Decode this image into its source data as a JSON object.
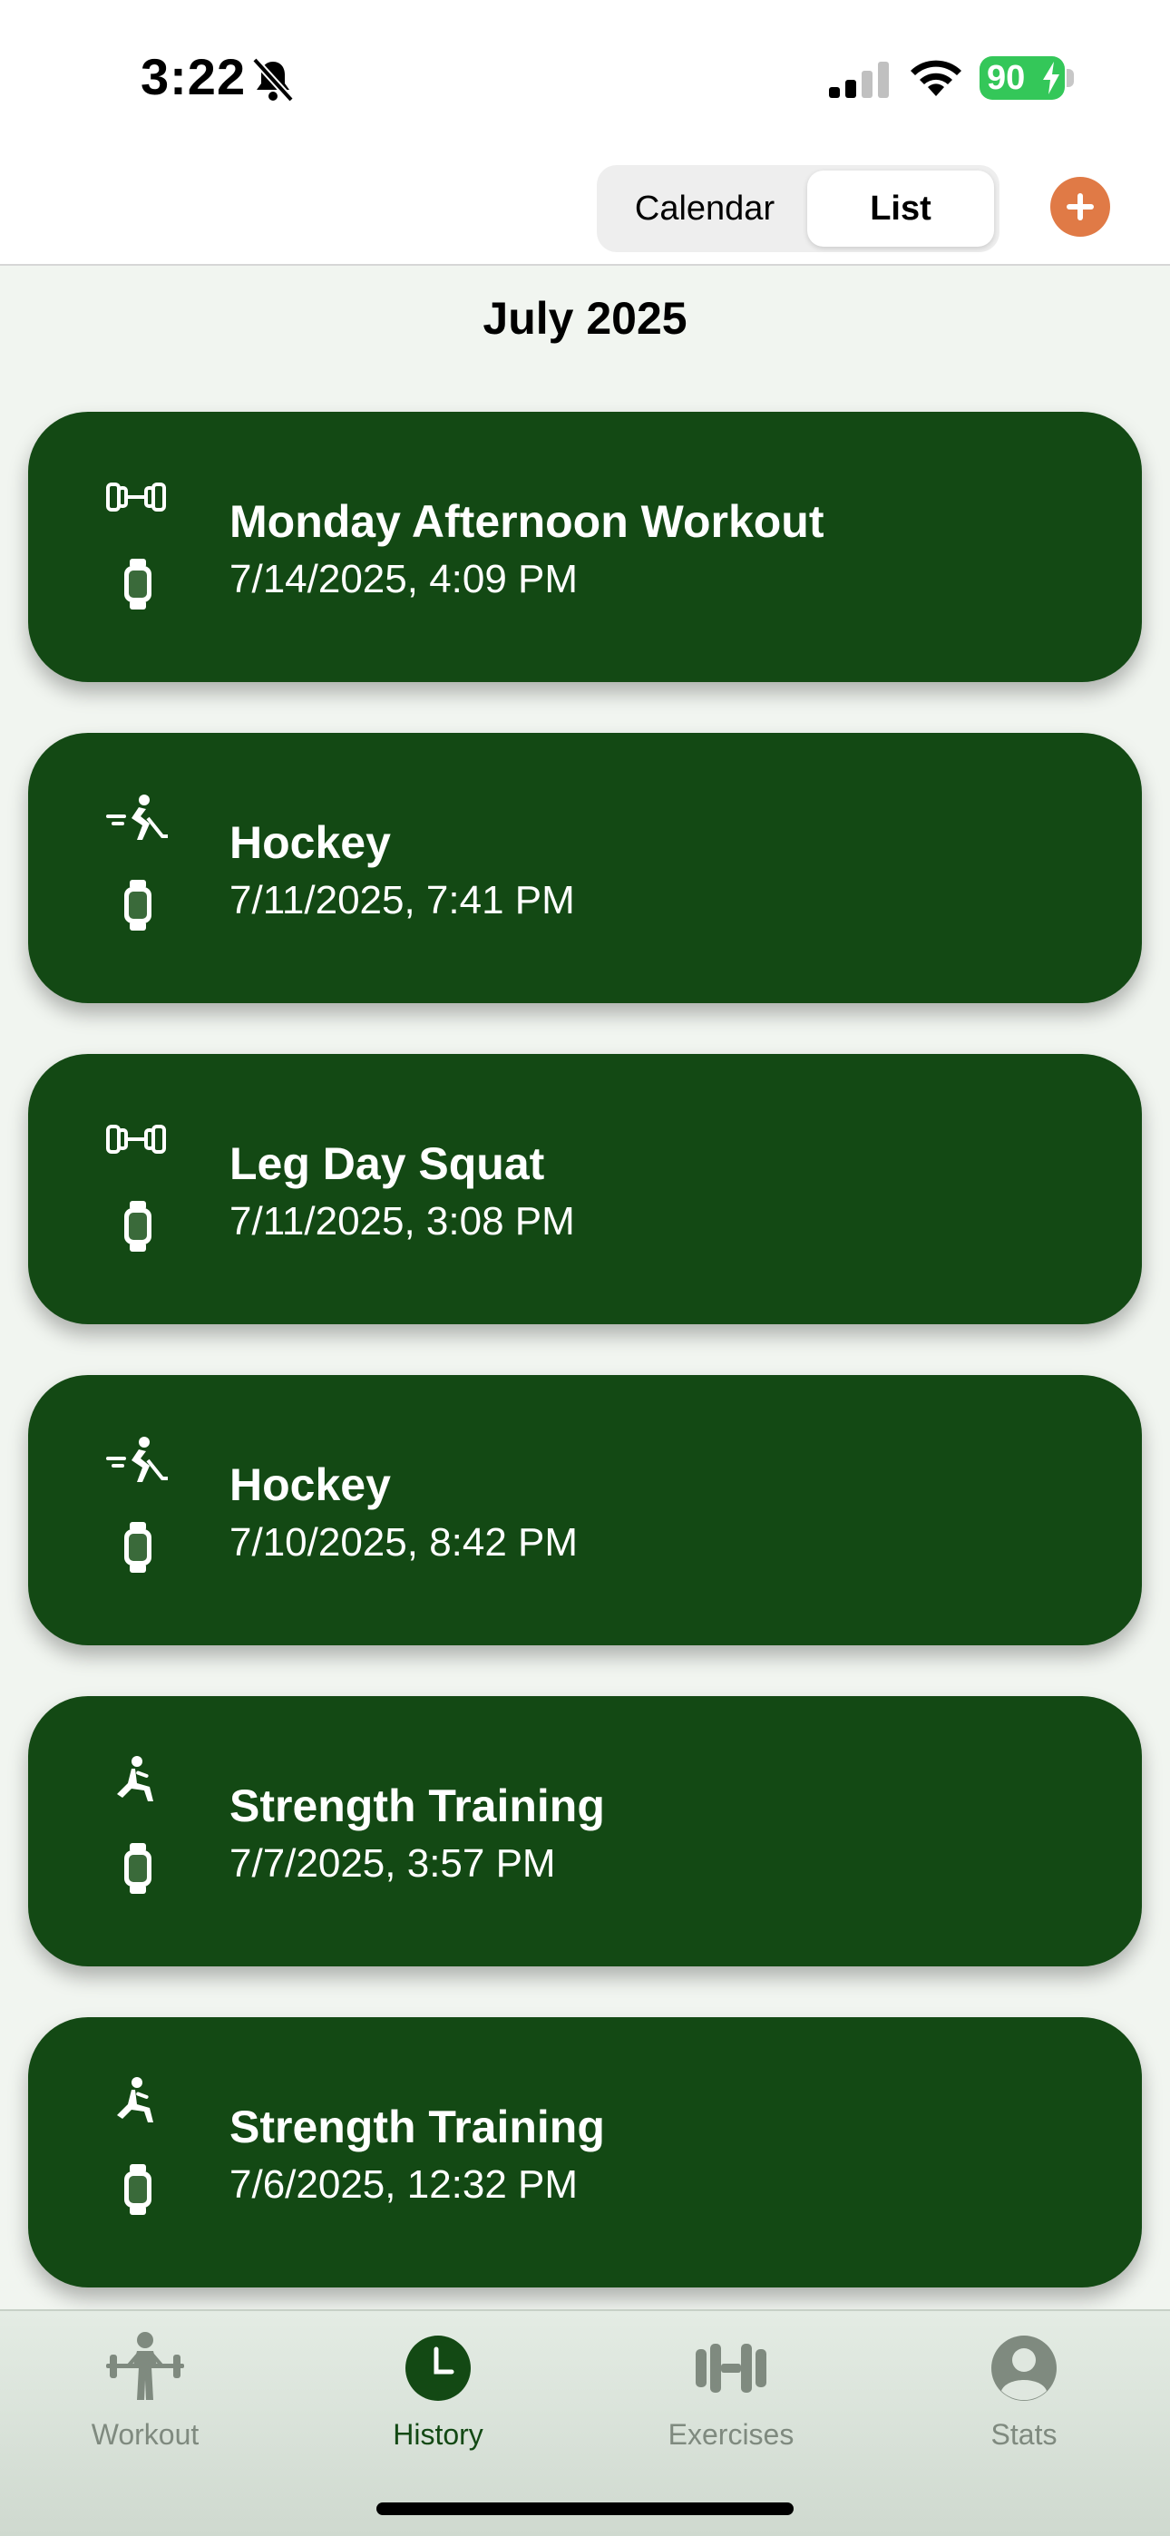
{
  "status": {
    "time": "3:22",
    "battery": "90",
    "icons": [
      "bell-slash-icon",
      "signal-icon",
      "wifi-icon",
      "battery-charging-icon"
    ]
  },
  "toolbar": {
    "segments": [
      "Calendar",
      "List"
    ],
    "selected": "List",
    "add_icon": "plus-icon",
    "accent": "#e07a46"
  },
  "month_header": "July 2025",
  "workouts": [
    {
      "title": "Monday Afternoon Workout",
      "date": "7/14/2025, 4:09 PM",
      "icon": "dumbbell-icon",
      "source_icon": "watch-icon"
    },
    {
      "title": "Hockey",
      "date": "7/11/2025, 7:41 PM",
      "icon": "hockey-icon",
      "source_icon": "watch-icon"
    },
    {
      "title": "Leg Day Squat",
      "date": "7/11/2025, 3:08 PM",
      "icon": "dumbbell-icon",
      "source_icon": "watch-icon"
    },
    {
      "title": "Hockey",
      "date": "7/10/2025, 8:42 PM",
      "icon": "hockey-icon",
      "source_icon": "watch-icon"
    },
    {
      "title": "Strength Training",
      "date": "7/7/2025, 3:57 PM",
      "icon": "lunge-icon",
      "source_icon": "watch-icon"
    },
    {
      "title": "Strength Training",
      "date": "7/6/2025, 12:32 PM",
      "icon": "lunge-icon",
      "source_icon": "watch-icon"
    }
  ],
  "colors": {
    "card": "#134914",
    "background": "#f1f5f0",
    "tab_active": "#134914",
    "tab_inactive": "#7f8a7f"
  },
  "tabs": [
    {
      "label": "Workout",
      "icon": "weightlifter-icon"
    },
    {
      "label": "History",
      "icon": "clock-icon",
      "active": true
    },
    {
      "label": "Exercises",
      "icon": "dumbbell-icon"
    },
    {
      "label": "Stats",
      "icon": "person-circle-icon"
    }
  ]
}
